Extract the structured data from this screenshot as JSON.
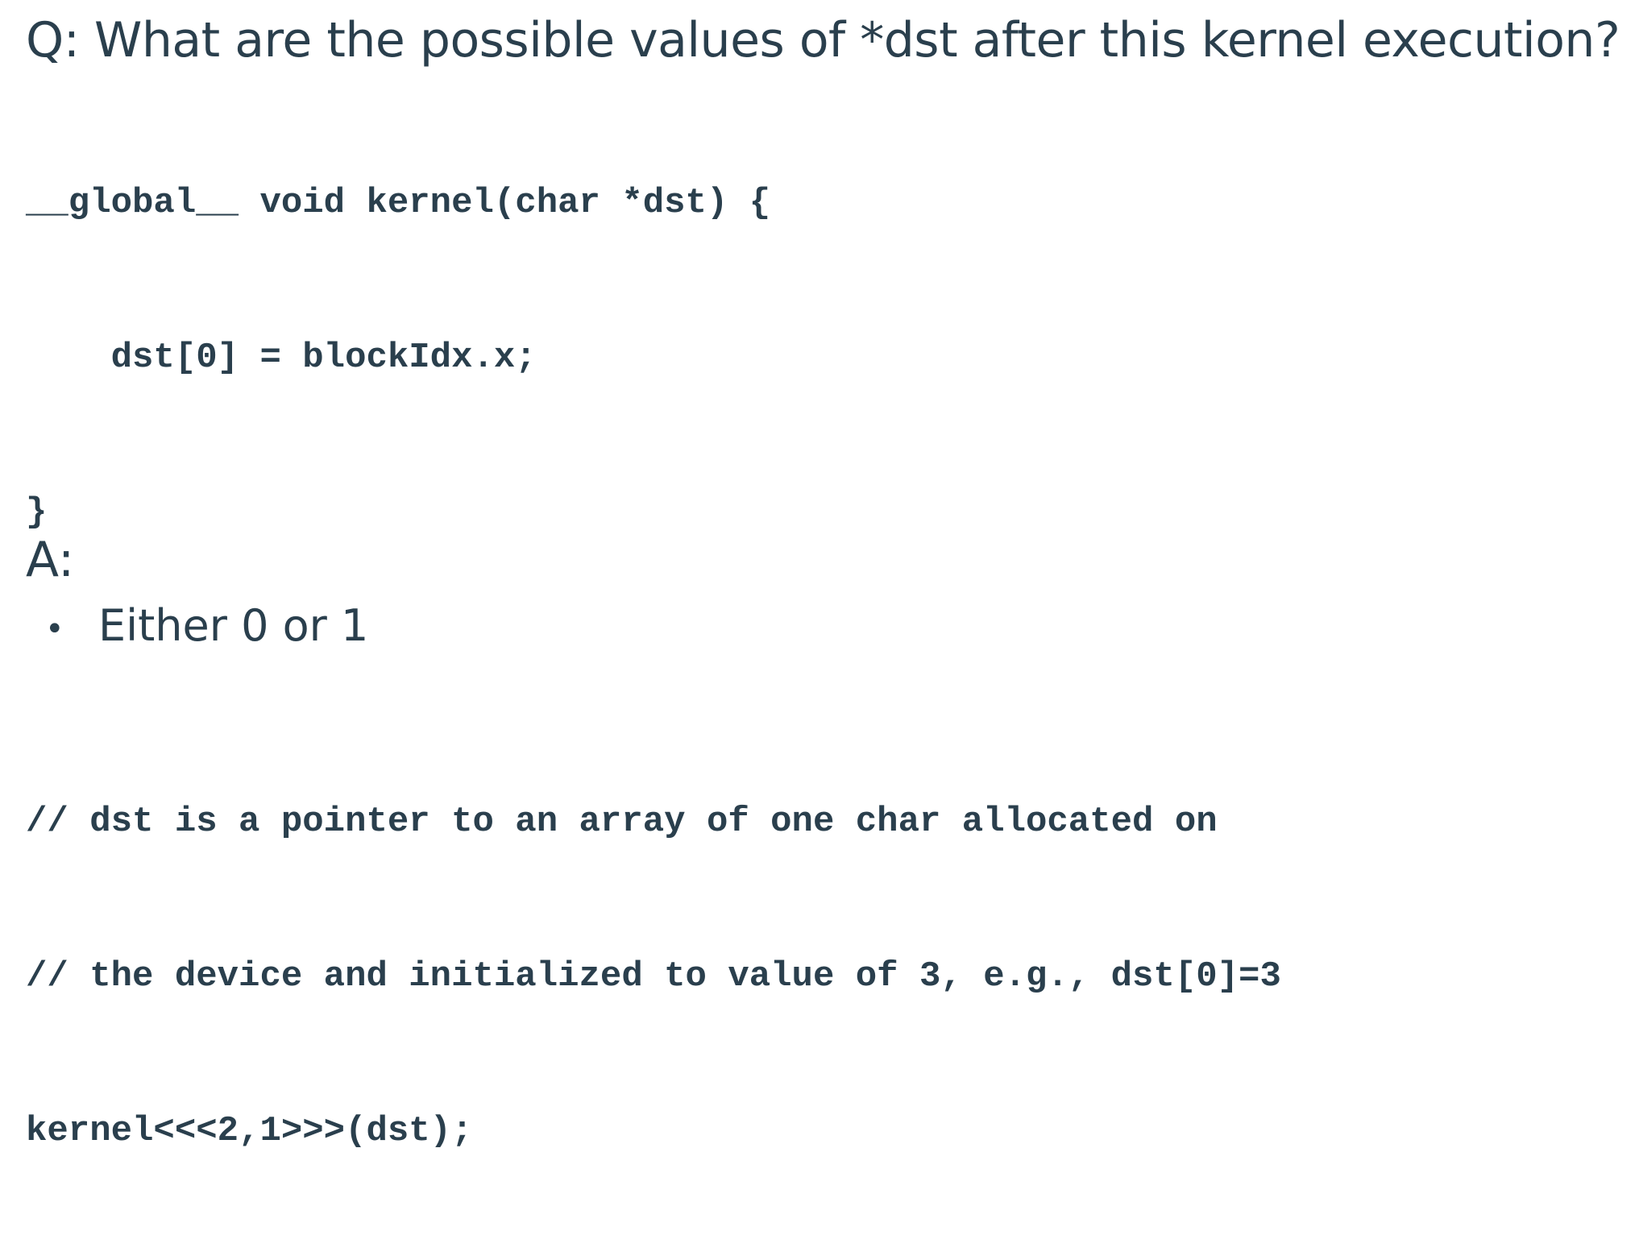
{
  "question": "Q: What are the possible values of *dst after this kernel execution?",
  "code": {
    "lines": [
      "__global__ void kernel(char *dst) {",
      "    dst[0] = blockIdx.x;",
      "}",
      "",
      "// dst is a pointer to an array of one char allocated on",
      "// the device and initialized to value of 3, e.g., dst[0]=3",
      "kernel<<<2,1>>>(dst);"
    ]
  },
  "answer": {
    "label": "A:",
    "items": [
      {
        "bullet": "•",
        "text": "Either 0 or 1"
      }
    ]
  }
}
